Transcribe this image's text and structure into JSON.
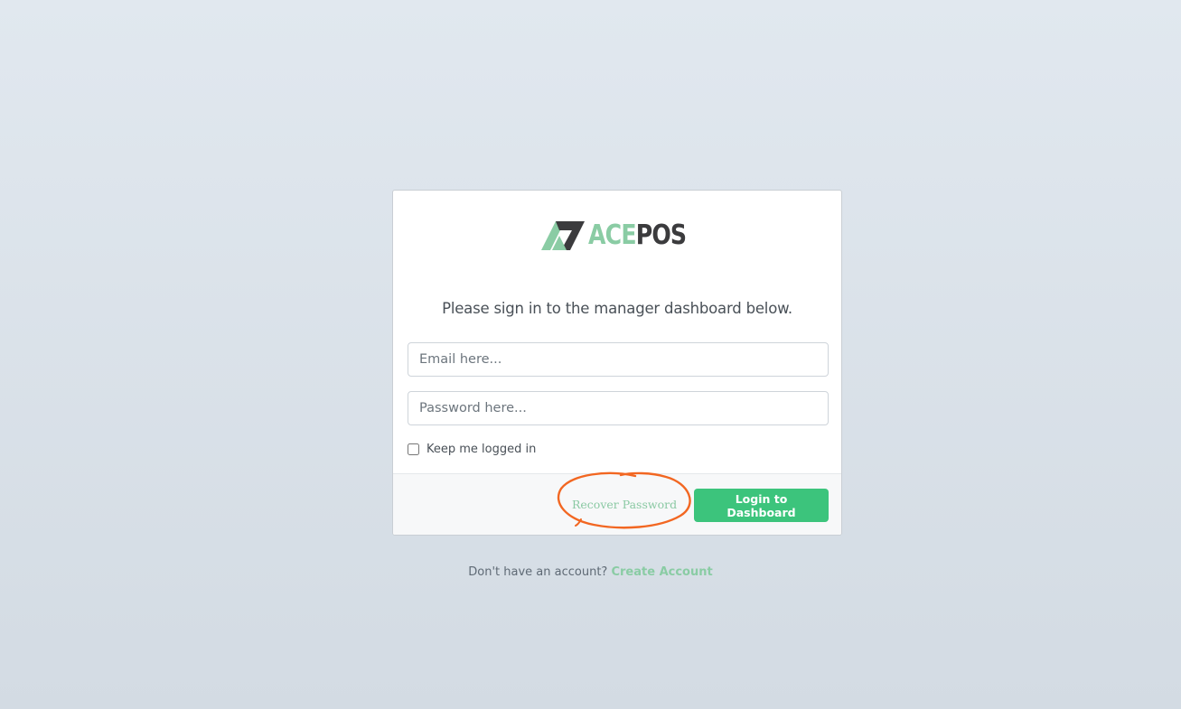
{
  "brand": {
    "name_part1": "ACE",
    "name_part2": "POS",
    "logo_icon": "acepos-logo-icon",
    "colors": {
      "accent_green": "#8acca4",
      "dark": "#3b3b3d"
    }
  },
  "login": {
    "subtitle": "Please sign in to the manager dashboard below.",
    "email_placeholder": "Email here...",
    "email_value": "",
    "password_placeholder": "Password here...",
    "password_value": "",
    "remember_label": "Keep me logged in",
    "remember_checked": false,
    "recover_label": "Recover Password",
    "submit_label": "Login to Dashboard",
    "button_color": "#3cc47c",
    "annotation_color": "#f26722"
  },
  "signup": {
    "prompt": "Don't have an account?",
    "link_label": "Create Account"
  }
}
